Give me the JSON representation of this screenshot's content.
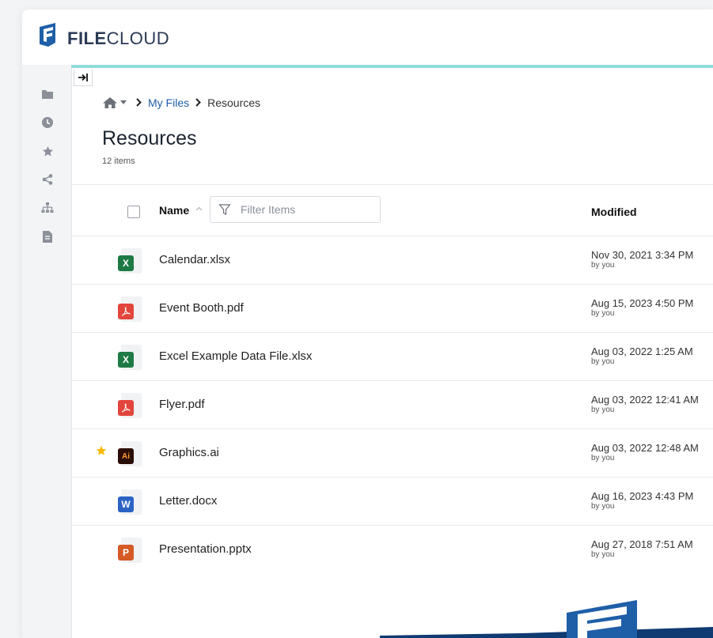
{
  "app": {
    "logo_text_bold": "FILE",
    "logo_text_rest": "CLOUD",
    "accent_color": "#8fdcd9"
  },
  "sidebar": {
    "items": [
      {
        "icon": "folder-icon"
      },
      {
        "icon": "clock-icon"
      },
      {
        "icon": "star-icon"
      },
      {
        "icon": "share-icon"
      },
      {
        "icon": "sitemap-icon"
      },
      {
        "icon": "document-icon"
      }
    ]
  },
  "breadcrumb": {
    "home_icon": "home-icon",
    "items": [
      "My Files",
      "Resources"
    ]
  },
  "page": {
    "title": "Resources",
    "item_count": "12 items"
  },
  "table": {
    "columns": {
      "name": "Name",
      "modified": "Modified"
    },
    "filter_placeholder": "Filter Items",
    "rows": [
      {
        "name": "Calendar.xlsx",
        "type": "xlsx",
        "badge": "X",
        "starred": false,
        "modified": "Nov 30, 2021 3:34 PM",
        "by": "by you"
      },
      {
        "name": "Event Booth.pdf",
        "type": "pdf",
        "badge": "",
        "starred": false,
        "modified": "Aug 15, 2023 4:50 PM",
        "by": "by you"
      },
      {
        "name": "Excel Example Data File.xlsx",
        "type": "xlsx",
        "badge": "X",
        "starred": false,
        "modified": "Aug 03, 2022 1:25 AM",
        "by": "by you"
      },
      {
        "name": "Flyer.pdf",
        "type": "pdf",
        "badge": "",
        "starred": false,
        "modified": "Aug 03, 2022 12:41 AM",
        "by": "by you"
      },
      {
        "name": "Graphics.ai",
        "type": "ai",
        "badge": "Ai",
        "starred": true,
        "modified": "Aug 03, 2022 12:48 AM",
        "by": "by you"
      },
      {
        "name": "Letter.docx",
        "type": "docx",
        "badge": "W",
        "starred": false,
        "modified": "Aug 16, 2023 4:43 PM",
        "by": "by you"
      },
      {
        "name": "Presentation.pptx",
        "type": "pptx",
        "badge": "P",
        "starred": false,
        "modified": "Aug 27, 2018 7:51 AM",
        "by": "by you"
      }
    ]
  }
}
